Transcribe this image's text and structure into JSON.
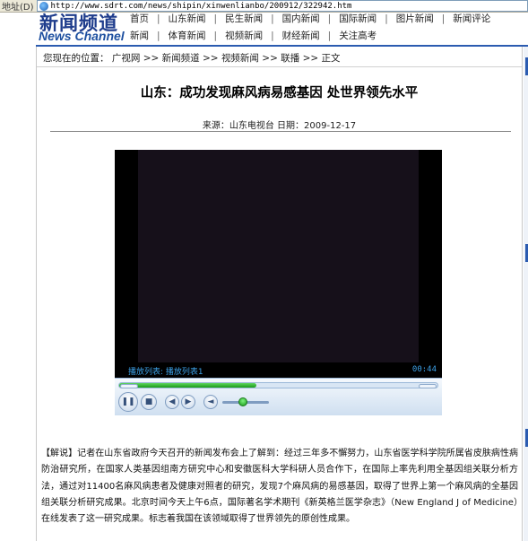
{
  "browser": {
    "address_label": "地址(D)",
    "url": "http://www.sdrt.com/news/shipin/xinwenlianbo/200912/322942.htm"
  },
  "header": {
    "logo_cn": "新闻频道",
    "logo_en": "News Channel",
    "nav_row1": [
      "首页",
      "山东新闻",
      "民生新闻",
      "国内新闻",
      "国际新闻",
      "图片新闻",
      "新闻评论"
    ],
    "nav_row2": [
      "新闻",
      "体育新闻",
      "视频新闻",
      "财经新闻",
      "关注高考"
    ]
  },
  "breadcrumb": {
    "prefix": "您现在的位置：",
    "items": [
      "广视网",
      "新闻频道",
      "视频新闻",
      "联播",
      "正文"
    ],
    "separator": ">>"
  },
  "article": {
    "title": "山东：成功发现麻风病易感基因 处世界领先水平",
    "source_label": "来源：山东电视台",
    "date_label": "日期：2009-12-17",
    "body": "【解说】记者在山东省政府今天召开的新闻发布会上了解到：经过三年多不懈努力，山东省医学科学院所属省皮肤病性病防治研究所，在国家人类基因组南方研究中心和安徽医科大学科研人员合作下，在国际上率先利用全基因组关联分析方法，通过对11400名麻风病患者及健康对照者的研究，发现7个麻风病的易感基因，取得了世界上第一个麻风病的全基因组关联分析研究成果。北京时间今天上午6点，国际著名学术期刊《新英格兰医学杂志》（New England J of Medicine）在线发表了这一研究成果。标志着我国在该领域取得了世界领先的原创性成果。"
  },
  "player": {
    "playlist_label": "播放列表: 播放列表1",
    "time": "00:44",
    "progress": 0.43,
    "volume": 0.45
  },
  "colors": {
    "brand_blue": "#1e3c8c",
    "header_line": "#2b5bb0",
    "player_text": "#3ca0e6"
  }
}
